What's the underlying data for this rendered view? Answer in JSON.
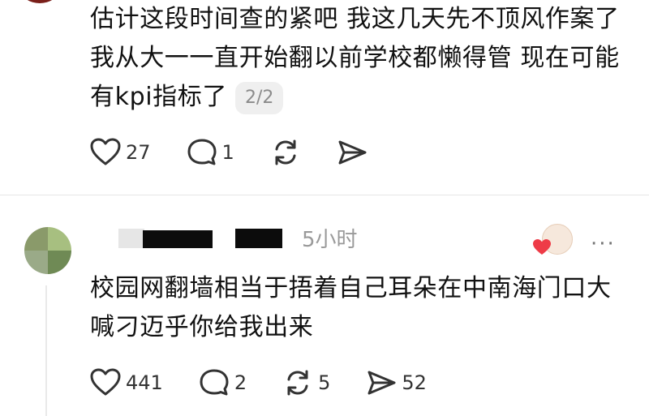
{
  "post": {
    "text": "估计这段时间查的紧吧 我这几天先不顶风作案了 我从大一一直开始翻以前学校都懒得管 现在可能有kpi指标了",
    "page_indicator": "2/2",
    "likes": "27",
    "replies": "1"
  },
  "comment": {
    "timestamp": "5小时",
    "text": "校园网翻墙相当于捂着自己耳朵在中南海门口大喊刁迈乎你给我出来",
    "likes": "441",
    "replies": "2",
    "reposts": "5",
    "shares": "52",
    "more": "···"
  },
  "icons": {
    "like": "heart-outline-icon",
    "reply": "speech-bubble-icon",
    "repost": "repost-arrows-icon",
    "share": "send-arrow-icon",
    "more": "ellipsis-icon"
  },
  "colors": {
    "heart_red": "#ee3b47",
    "muted": "#9a9a9a",
    "text": "#111111"
  }
}
